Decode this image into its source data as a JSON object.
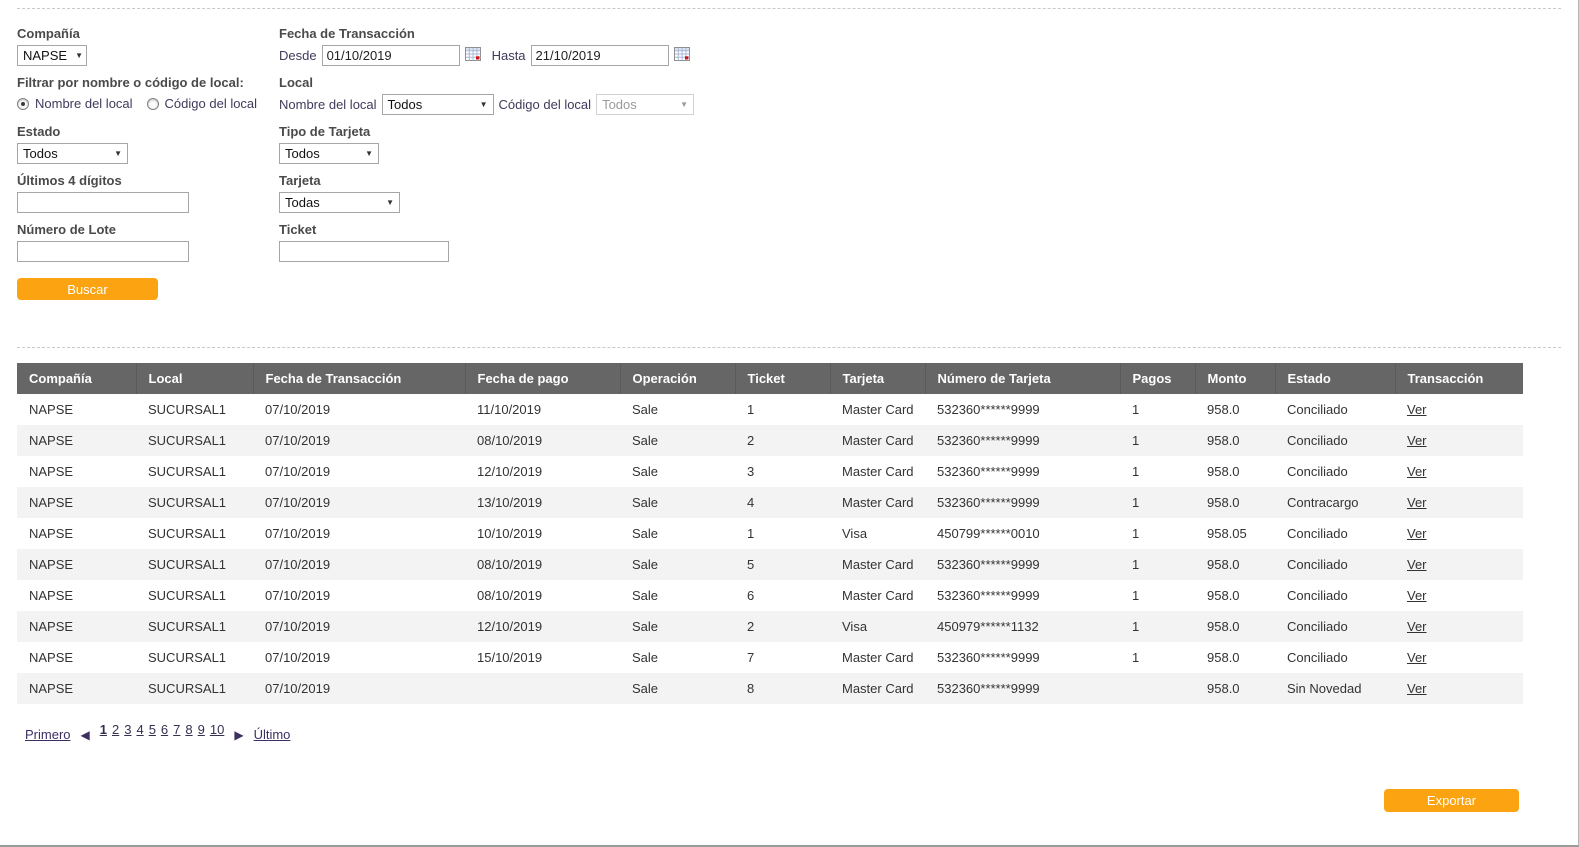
{
  "colors": {
    "accent_orange": "#fca311",
    "table_header_bg": "#666666",
    "row_alt_bg": "#f3f3f3",
    "link_purple": "#3e2f63",
    "label_gray": "#4a4a4a"
  },
  "filters": {
    "compania": {
      "label": "Compañía",
      "value": "NAPSE"
    },
    "fecha_transaccion": {
      "label": "Fecha de Transacción",
      "desde_label": "Desde",
      "desde_value": "01/10/2019",
      "hasta_label": "Hasta",
      "hasta_value": "21/10/2019"
    },
    "filtrar_por": {
      "label": "Filtrar por nombre o código de local:",
      "options": [
        {
          "label": "Nombre del local",
          "selected": true
        },
        {
          "label": "Código del local",
          "selected": false
        }
      ]
    },
    "local": {
      "label": "Local",
      "nombre_label": "Nombre del local",
      "nombre_value": "Todos",
      "codigo_label": "Código del local",
      "codigo_value": "Todos"
    },
    "estado": {
      "label": "Estado",
      "value": "Todos"
    },
    "tipo_tarjeta": {
      "label": "Tipo de Tarjeta",
      "value": "Todos"
    },
    "ultimos4": {
      "label": "Últimos 4 dígitos",
      "value": ""
    },
    "tarjeta": {
      "label": "Tarjeta",
      "value": "Todas"
    },
    "numero_lote": {
      "label": "Número de Lote",
      "value": ""
    },
    "ticket": {
      "label": "Ticket",
      "value": ""
    },
    "buscar_label": "Buscar"
  },
  "table": {
    "columns": [
      "Compañía",
      "Local",
      "Fecha de Transacción",
      "Fecha de pago",
      "Operación",
      "Ticket",
      "Tarjeta",
      "Número de Tarjeta",
      "Pagos",
      "Monto",
      "Estado",
      "Transacción"
    ],
    "rows": [
      [
        "NAPSE",
        "SUCURSAL1",
        "07/10/2019",
        "11/10/2019",
        "Sale",
        "1",
        "Master Card",
        "532360******9999",
        "1",
        "958.0",
        "Conciliado",
        "Ver"
      ],
      [
        "NAPSE",
        "SUCURSAL1",
        "07/10/2019",
        "08/10/2019",
        "Sale",
        "2",
        "Master Card",
        "532360******9999",
        "1",
        "958.0",
        "Conciliado",
        "Ver"
      ],
      [
        "NAPSE",
        "SUCURSAL1",
        "07/10/2019",
        "12/10/2019",
        "Sale",
        "3",
        "Master Card",
        "532360******9999",
        "1",
        "958.0",
        "Conciliado",
        "Ver"
      ],
      [
        "NAPSE",
        "SUCURSAL1",
        "07/10/2019",
        "13/10/2019",
        "Sale",
        "4",
        "Master Card",
        "532360******9999",
        "1",
        "958.0",
        "Contracargo",
        "Ver"
      ],
      [
        "NAPSE",
        "SUCURSAL1",
        "07/10/2019",
        "10/10/2019",
        "Sale",
        "1",
        "Visa",
        "450799******0010",
        "1",
        "958.05",
        "Conciliado",
        "Ver"
      ],
      [
        "NAPSE",
        "SUCURSAL1",
        "07/10/2019",
        "08/10/2019",
        "Sale",
        "5",
        "Master Card",
        "532360******9999",
        "1",
        "958.0",
        "Conciliado",
        "Ver"
      ],
      [
        "NAPSE",
        "SUCURSAL1",
        "07/10/2019",
        "08/10/2019",
        "Sale",
        "6",
        "Master Card",
        "532360******9999",
        "1",
        "958.0",
        "Conciliado",
        "Ver"
      ],
      [
        "NAPSE",
        "SUCURSAL1",
        "07/10/2019",
        "12/10/2019",
        "Sale",
        "2",
        "Visa",
        "450979******1132",
        "1",
        "958.0",
        "Conciliado",
        "Ver"
      ],
      [
        "NAPSE",
        "SUCURSAL1",
        "07/10/2019",
        "15/10/2019",
        "Sale",
        "7",
        "Master Card",
        "532360******9999",
        "1",
        "958.0",
        "Conciliado",
        "Ver"
      ],
      [
        "NAPSE",
        "SUCURSAL1",
        "07/10/2019",
        "",
        "Sale",
        "8",
        "Master Card",
        "532360******9999",
        "",
        "958.0",
        "Sin Novedad",
        "Ver"
      ]
    ]
  },
  "pagination": {
    "primero_label": "Primero",
    "ultimo_label": "Último",
    "pages": [
      "1",
      "2",
      "3",
      "4",
      "5",
      "6",
      "7",
      "8",
      "9",
      "10"
    ],
    "current": "1"
  },
  "exportar_label": "Exportar"
}
